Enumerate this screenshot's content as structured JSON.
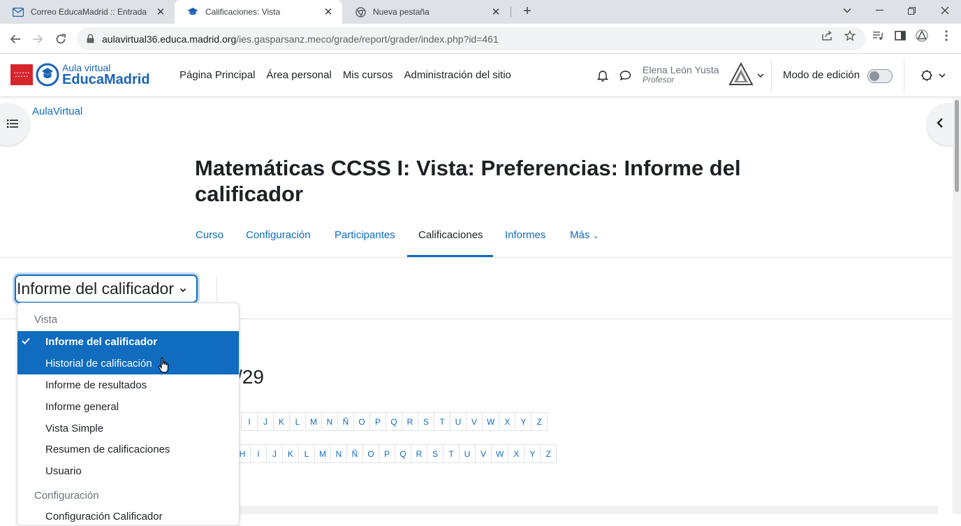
{
  "browser": {
    "tabs": [
      {
        "title": "Correo EducaMadrid :: Entrada",
        "icon": "mail-icon"
      },
      {
        "title": "Calificaciones: Vista",
        "icon": "graduation-cap-icon",
        "active": true
      },
      {
        "title": "Nueva pestaña",
        "icon": "chrome-icon"
      }
    ],
    "url_host": "aulavirtual36.educa.madrid.org",
    "url_path": "/ies.gasparsanz.meco/grade/report/grader/index.php?id=461"
  },
  "navbar": {
    "logo_small": "Aula virtual",
    "logo_big": "EducaMadrid",
    "links": [
      "Página Principal",
      "Área personal",
      "Mis cursos",
      "Administración del sitio"
    ],
    "user_name": "Elena León Yusta",
    "user_role": "Profesor",
    "edit_mode_label": "Modo de edición",
    "edit_mode_on": false
  },
  "breadcrumb": "AulaVirtual",
  "page": {
    "title": "Matemáticas CCSS I: Vista: Preferencias: Informe del calificador",
    "secondary_nav": [
      "Curso",
      "Configuración",
      "Participantes",
      "Calificaciones",
      "Informes",
      "Más"
    ],
    "active_tab": "Calificaciones",
    "selector_value": "Informe del calificador",
    "partial_heading": "/29",
    "letters_row1": [
      "I",
      "J",
      "K",
      "L",
      "M",
      "N",
      "Ñ",
      "O",
      "P",
      "Q",
      "R",
      "S",
      "T",
      "U",
      "V",
      "W",
      "X",
      "Y",
      "Z"
    ],
    "letters_row2": [
      "H",
      "I",
      "J",
      "K",
      "L",
      "M",
      "N",
      "Ñ",
      "O",
      "P",
      "Q",
      "R",
      "S",
      "T",
      "U",
      "V",
      "W",
      "X",
      "Y",
      "Z"
    ]
  },
  "dropdown": {
    "group1": "Vista",
    "items": [
      {
        "label": "Informe del calificador",
        "state": "selected"
      },
      {
        "label": "Historial de calificación",
        "state": "hover"
      },
      {
        "label": "Informe de resultados",
        "state": ""
      },
      {
        "label": "Informe general",
        "state": ""
      },
      {
        "label": "Vista Simple",
        "state": ""
      },
      {
        "label": "Resumen de calificaciones",
        "state": ""
      },
      {
        "label": "Usuario",
        "state": ""
      }
    ],
    "group2": "Configuración",
    "partial_item": "Configuración Calificador"
  },
  "colors": {
    "accent": "#0f6cbf",
    "brand_red": "#d7262b",
    "brand_blue": "#1a63b7"
  }
}
